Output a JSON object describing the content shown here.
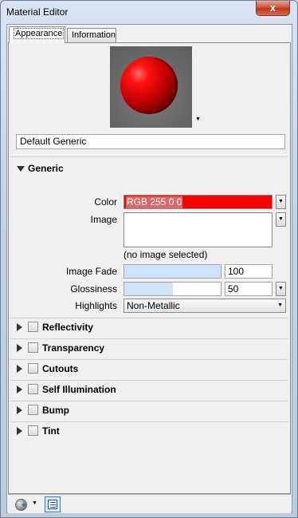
{
  "window": {
    "title": "Material Editor",
    "close_label": "x"
  },
  "tabs": [
    {
      "label": "Appearance"
    },
    {
      "label": "Information"
    }
  ],
  "material_name": "Default Generic",
  "generic": {
    "header": "Generic",
    "color": {
      "label": "Color",
      "value": "RGB 255 0 0",
      "swatch": "#ff0000"
    },
    "image": {
      "label": "Image",
      "empty_text": "(no image selected)"
    },
    "image_fade": {
      "label": "Image Fade",
      "value": "100",
      "percent": 100
    },
    "glossiness": {
      "label": "Glossiness",
      "value": "50",
      "percent": 50
    },
    "highlights": {
      "label": "Highlights",
      "value": "Non-Metallic"
    }
  },
  "sections": [
    {
      "label": "Reflectivity"
    },
    {
      "label": "Transparency"
    },
    {
      "label": "Cutouts"
    },
    {
      "label": "Self Illumination"
    },
    {
      "label": "Bump"
    },
    {
      "label": "Tint"
    }
  ],
  "icons": {
    "close": "close-icon",
    "preview_dropdown": "chevron-down-icon",
    "add_material": "globe-add-icon",
    "panel": "panel-icon"
  }
}
